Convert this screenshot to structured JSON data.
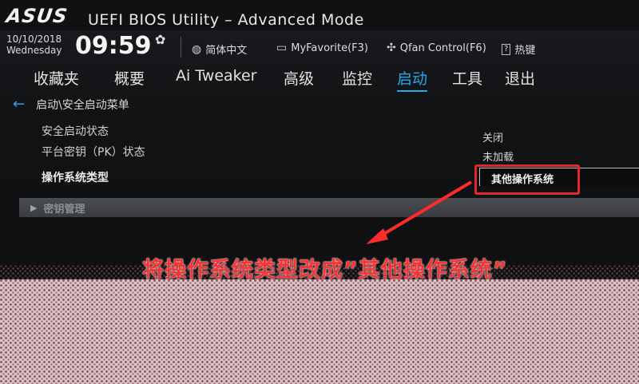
{
  "header": {
    "logo": "ASUS",
    "title": "UEFI BIOS Utility – Advanced Mode",
    "date": "10/10/2018",
    "weekday": "Wednesday",
    "time": "09:59",
    "language": "简体中文",
    "myfavorite": "MyFavorite(F3)",
    "qfan": "Qfan Control(F6)",
    "hotkey_icon": "?",
    "hotkey": "热键"
  },
  "tabs": [
    {
      "label": "收藏夹",
      "active": false
    },
    {
      "label": "概要",
      "active": false
    },
    {
      "label": "Ai Tweaker",
      "active": false
    },
    {
      "label": "高级",
      "active": false
    },
    {
      "label": "监控",
      "active": false
    },
    {
      "label": "启动",
      "active": true
    },
    {
      "label": "工具",
      "active": false
    },
    {
      "label": "退出",
      "active": false
    }
  ],
  "breadcrumb": "启动\\安全启动菜单",
  "settings": [
    {
      "label": "安全启动状态",
      "value": "关闭"
    },
    {
      "label": "平台密钥（PK）状态",
      "value": "未加载"
    },
    {
      "label": "操作系统类型",
      "value": "其他操作系统"
    }
  ],
  "section": "密钥管理",
  "annotation": "将操作系统类型改成”其他操作系统”",
  "colors": {
    "accent": "#29a8e8",
    "annotation": "#ff3030"
  },
  "icons": [
    "gear-icon",
    "globe-icon",
    "favorite-icon",
    "fan-icon",
    "help-icon",
    "back-arrow-icon",
    "expand-triangle-icon"
  ]
}
